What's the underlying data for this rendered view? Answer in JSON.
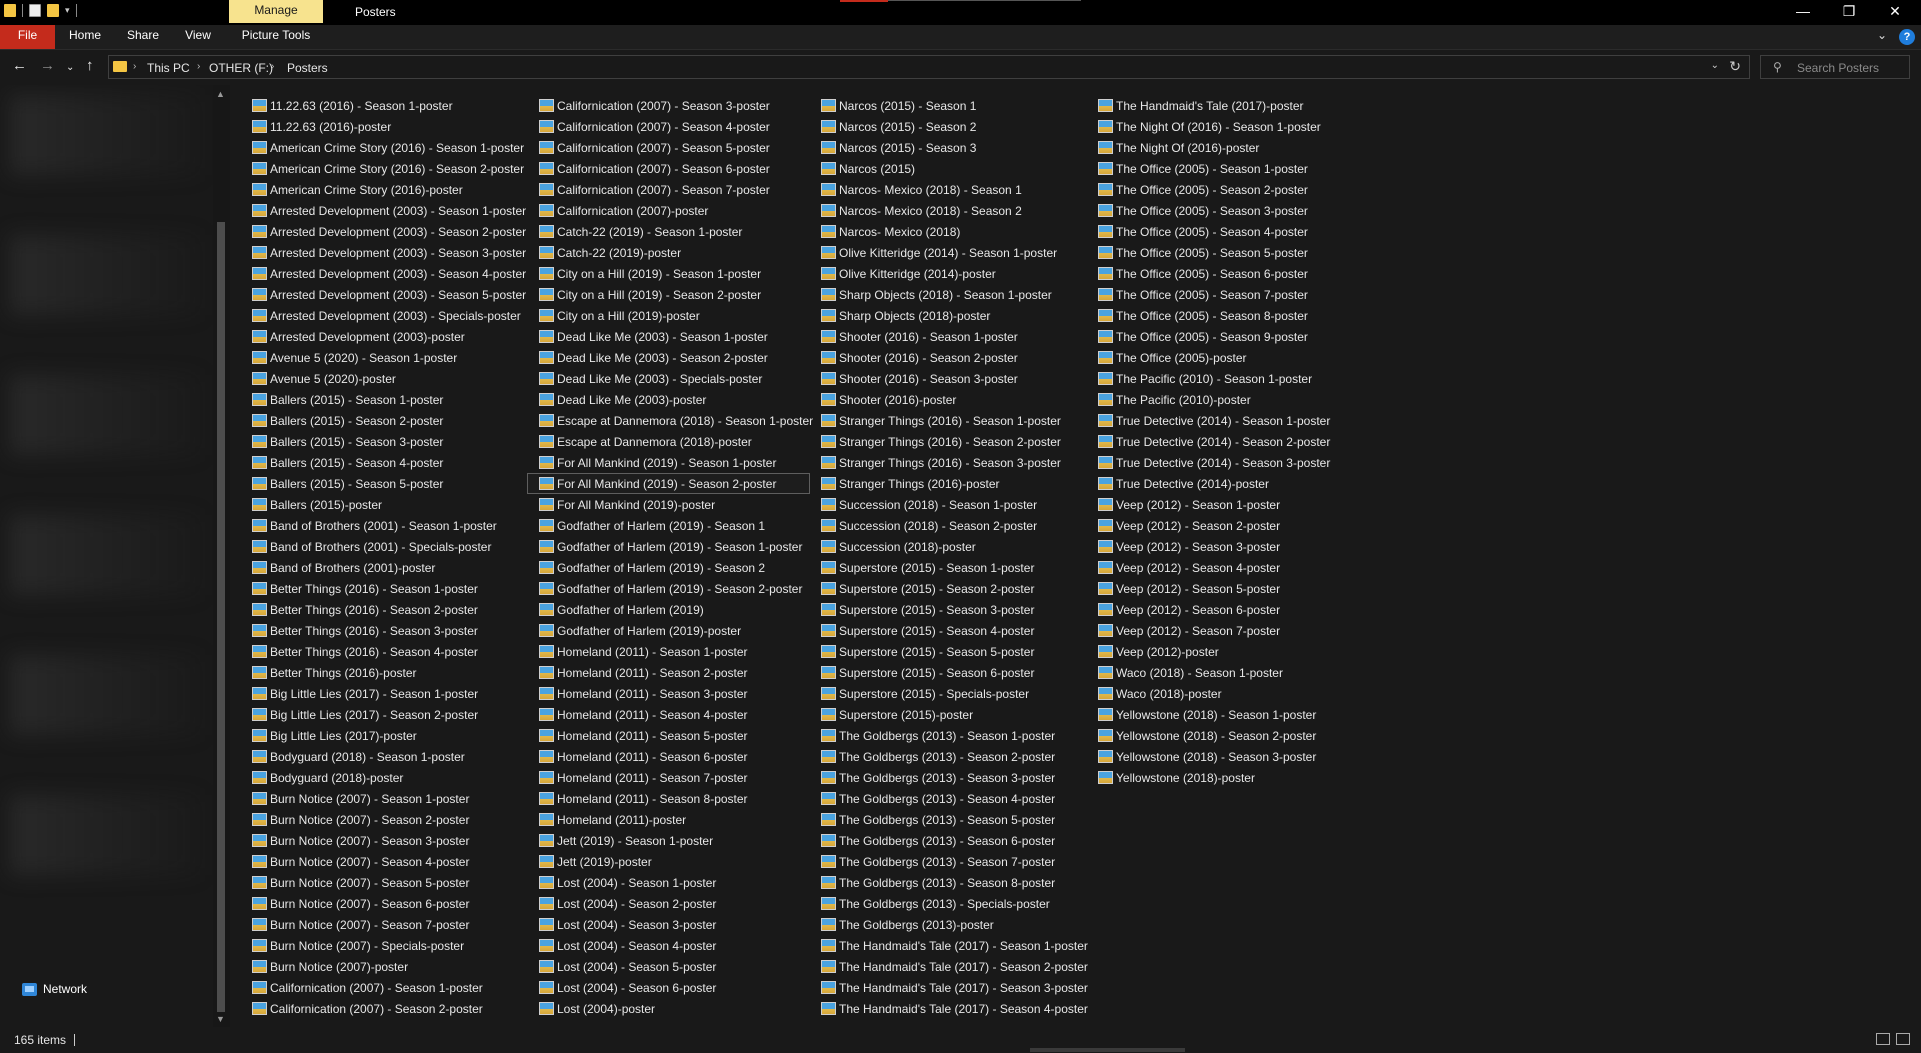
{
  "titlebar": {
    "manage_tab": "Manage",
    "window_title": "Posters",
    "minimize": "—",
    "maximize": "❐",
    "close": "✕"
  },
  "ribbon": {
    "tabs": [
      "File",
      "Home",
      "Share",
      "View",
      "Picture Tools"
    ],
    "file_color": "#c42b1c",
    "manage_color": "#f7e38e"
  },
  "address": {
    "crumbs": [
      "This PC",
      "OTHER (F:)",
      "Posters"
    ]
  },
  "search": {
    "placeholder": "Search Posters"
  },
  "navpane": {
    "network_label": "Network"
  },
  "status": {
    "item_count": "165 items"
  },
  "files": {
    "columns": [
      [
        "11.22.63 (2016) - Season 1-poster",
        "11.22.63 (2016)-poster",
        "American Crime Story (2016) - Season 1-poster",
        "American Crime Story (2016) - Season 2-poster",
        "American Crime Story (2016)-poster",
        "Arrested Development (2003) - Season 1-poster",
        "Arrested Development (2003) - Season 2-poster",
        "Arrested Development (2003) - Season 3-poster",
        "Arrested Development (2003) - Season 4-poster",
        "Arrested Development (2003) - Season 5-poster",
        "Arrested Development (2003) - Specials-poster",
        "Arrested Development (2003)-poster",
        "Avenue 5 (2020) - Season 1-poster",
        "Avenue 5 (2020)-poster",
        "Ballers (2015) - Season 1-poster",
        "Ballers (2015) - Season 2-poster",
        "Ballers (2015) - Season 3-poster",
        "Ballers (2015) - Season 4-poster",
        "Ballers (2015) - Season 5-poster",
        "Ballers (2015)-poster",
        "Band of Brothers (2001) - Season 1-poster",
        "Band of Brothers (2001) - Specials-poster",
        "Band of Brothers (2001)-poster",
        "Better Things (2016) - Season 1-poster",
        "Better Things (2016) - Season 2-poster",
        "Better Things (2016) - Season 3-poster",
        "Better Things (2016) - Season 4-poster",
        "Better Things (2016)-poster",
        "Big Little Lies (2017) - Season 1-poster",
        "Big Little Lies (2017) - Season 2-poster",
        "Big Little Lies (2017)-poster",
        "Bodyguard (2018) - Season 1-poster",
        "Bodyguard (2018)-poster",
        "Burn Notice (2007) - Season 1-poster",
        "Burn Notice (2007) - Season 2-poster",
        "Burn Notice (2007) - Season 3-poster",
        "Burn Notice (2007) - Season 4-poster",
        "Burn Notice (2007) - Season 5-poster",
        "Burn Notice (2007) - Season 6-poster",
        "Burn Notice (2007) - Season 7-poster",
        "Burn Notice (2007) - Specials-poster",
        "Burn Notice (2007)-poster",
        "Californication (2007) - Season 1-poster",
        "Californication (2007) - Season 2-poster"
      ],
      [
        "Californication (2007) - Season 3-poster",
        "Californication (2007) - Season 4-poster",
        "Californication (2007) - Season 5-poster",
        "Californication (2007) - Season 6-poster",
        "Californication (2007) - Season 7-poster",
        "Californication (2007)-poster",
        "Catch-22 (2019) - Season 1-poster",
        "Catch-22 (2019)-poster",
        "City on a Hill (2019) - Season 1-poster",
        "City on a Hill (2019) - Season 2-poster",
        "City on a Hill (2019)-poster",
        "Dead Like Me (2003) - Season 1-poster",
        "Dead Like Me (2003) - Season 2-poster",
        "Dead Like Me (2003) - Specials-poster",
        "Dead Like Me (2003)-poster",
        "Escape at Dannemora (2018) - Season 1-poster",
        "Escape at Dannemora (2018)-poster",
        "For All Mankind (2019) - Season 1-poster",
        "For All Mankind (2019) - Season 2-poster",
        "For All Mankind (2019)-poster",
        "Godfather of Harlem (2019) - Season 1",
        "Godfather of Harlem (2019) - Season 1-poster",
        "Godfather of Harlem (2019) - Season 2",
        "Godfather of Harlem (2019) - Season 2-poster",
        "Godfather of Harlem (2019)",
        "Godfather of Harlem (2019)-poster",
        "Homeland (2011) - Season 1-poster",
        "Homeland (2011) - Season 2-poster",
        "Homeland (2011) - Season 3-poster",
        "Homeland (2011) - Season 4-poster",
        "Homeland (2011) - Season 5-poster",
        "Homeland (2011) - Season 6-poster",
        "Homeland (2011) - Season 7-poster",
        "Homeland (2011) - Season 8-poster",
        "Homeland (2011)-poster",
        "Jett (2019) - Season 1-poster",
        "Jett (2019)-poster",
        "Lost (2004) - Season 1-poster",
        "Lost (2004) - Season 2-poster",
        "Lost (2004) - Season 3-poster",
        "Lost (2004) - Season 4-poster",
        "Lost (2004) - Season 5-poster",
        "Lost (2004) - Season 6-poster",
        "Lost (2004)-poster"
      ],
      [
        "Narcos (2015) - Season 1",
        "Narcos (2015) - Season 2",
        "Narcos (2015) - Season 3",
        "Narcos (2015)",
        "Narcos- Mexico (2018) - Season 1",
        "Narcos- Mexico (2018) - Season 2",
        "Narcos- Mexico (2018)",
        "Olive Kitteridge (2014) - Season 1-poster",
        "Olive Kitteridge (2014)-poster",
        "Sharp Objects (2018) - Season 1-poster",
        "Sharp Objects (2018)-poster",
        "Shooter (2016) - Season 1-poster",
        "Shooter (2016) - Season 2-poster",
        "Shooter (2016) - Season 3-poster",
        "Shooter (2016)-poster",
        "Stranger Things (2016) - Season 1-poster",
        "Stranger Things (2016) - Season 2-poster",
        "Stranger Things (2016) - Season 3-poster",
        "Stranger Things (2016)-poster",
        "Succession (2018) - Season 1-poster",
        "Succession (2018) - Season 2-poster",
        "Succession (2018)-poster",
        "Superstore (2015) - Season 1-poster",
        "Superstore (2015) - Season 2-poster",
        "Superstore (2015) - Season 3-poster",
        "Superstore (2015) - Season 4-poster",
        "Superstore (2015) - Season 5-poster",
        "Superstore (2015) - Season 6-poster",
        "Superstore (2015) - Specials-poster",
        "Superstore (2015)-poster",
        "The Goldbergs (2013) - Season 1-poster",
        "The Goldbergs (2013) - Season 2-poster",
        "The Goldbergs (2013) - Season 3-poster",
        "The Goldbergs (2013) - Season 4-poster",
        "The Goldbergs (2013) - Season 5-poster",
        "The Goldbergs (2013) - Season 6-poster",
        "The Goldbergs (2013) - Season 7-poster",
        "The Goldbergs (2013) - Season 8-poster",
        "The Goldbergs (2013) - Specials-poster",
        "The Goldbergs (2013)-poster",
        "The Handmaid's Tale (2017) - Season 1-poster",
        "The Handmaid's Tale (2017) - Season 2-poster",
        "The Handmaid's Tale (2017) - Season 3-poster",
        "The Handmaid's Tale (2017) - Season 4-poster"
      ],
      [
        "The Handmaid's Tale (2017)-poster",
        "The Night Of (2016) - Season 1-poster",
        "The Night Of (2016)-poster",
        "The Office (2005) - Season 1-poster",
        "The Office (2005) - Season 2-poster",
        "The Office (2005) - Season 3-poster",
        "The Office (2005) - Season 4-poster",
        "The Office (2005) - Season 5-poster",
        "The Office (2005) - Season 6-poster",
        "The Office (2005) - Season 7-poster",
        "The Office (2005) - Season 8-poster",
        "The Office (2005) - Season 9-poster",
        "The Office (2005)-poster",
        "The Pacific (2010) - Season 1-poster",
        "The Pacific (2010)-poster",
        "True Detective (2014) - Season 1-poster",
        "True Detective (2014) - Season 2-poster",
        "True Detective (2014) - Season 3-poster",
        "True Detective (2014)-poster",
        "Veep (2012) - Season 1-poster",
        "Veep (2012) - Season 2-poster",
        "Veep (2012) - Season 3-poster",
        "Veep (2012) - Season 4-poster",
        "Veep (2012) - Season 5-poster",
        "Veep (2012) - Season 6-poster",
        "Veep (2012) - Season 7-poster",
        "Veep (2012)-poster",
        "Waco (2018) - Season 1-poster",
        "Waco (2018)-poster",
        "Yellowstone (2018) - Season 1-poster",
        "Yellowstone (2018) - Season 2-poster",
        "Yellowstone (2018) - Season 3-poster",
        "Yellowstone (2018)-poster"
      ]
    ],
    "selected": "For All Mankind (2019) - Season 2-poster"
  }
}
